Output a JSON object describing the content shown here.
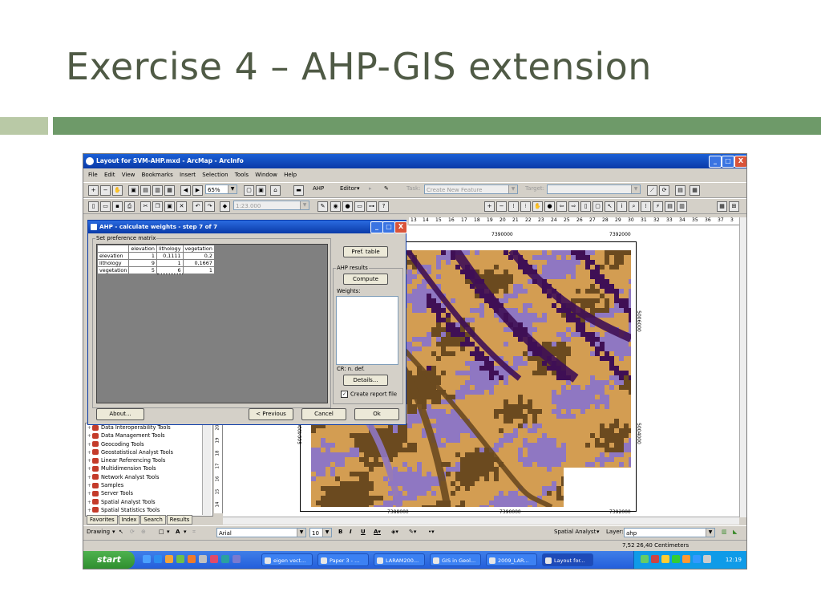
{
  "slide": {
    "title": "Exercise 4 – AHP-GIS extension"
  },
  "window": {
    "title": "Layout for SVM-AHP.mxd - ArcMap - ArcInfo",
    "controls": {
      "minimize": "_",
      "maximize": "□",
      "close": "X"
    }
  },
  "menu": [
    "File",
    "Edit",
    "View",
    "Bookmarks",
    "Insert",
    "Selection",
    "Tools",
    "Window",
    "Help"
  ],
  "toolbar": {
    "zoom": "65%",
    "ahp_label": "AHP",
    "editor_label": "Editor",
    "task_label": "Task:",
    "task_value": "Create New Feature",
    "target_label": "Target:",
    "scale_value": "1:23.000"
  },
  "dialog": {
    "title": "AHP - calculate weights - step 7 of 7",
    "controls": {
      "minimize": "_",
      "maximize": "□",
      "close": "X"
    },
    "group_matrix": "Set preference matrix",
    "matrix": {
      "columns": [
        "elevation",
        "lithology",
        "vegetation"
      ],
      "rows": [
        {
          "name": "elevation",
          "values": [
            "1",
            "0,1111",
            "0,2"
          ]
        },
        {
          "name": "lithology",
          "values": [
            "9",
            "1",
            "0,1667"
          ]
        },
        {
          "name": "vegetation",
          "values": [
            "5",
            "6",
            "1"
          ]
        }
      ]
    },
    "pref_table_button": "Pref. table",
    "group_results": "AHP results",
    "compute_button": "Compute",
    "weights_label": "Weights:",
    "cr_text": "CR: n. def.",
    "details_button": "Details...",
    "create_report_checked": true,
    "create_report_label": "Create report file",
    "about_button": "About...",
    "previous_button": "< Previous",
    "cancel_button": "Cancel",
    "ok_button": "Ok"
  },
  "toc": {
    "items": [
      "Data Interoperability Tools",
      "Data Management Tools",
      "Geocoding Tools",
      "Geostatistical Analyst Tools",
      "Linear Referencing Tools",
      "Multidimension Tools",
      "Network Analyst Tools",
      "Samples",
      "Server Tools",
      "Spatial Analyst Tools",
      "Spatial Statistics Tools"
    ],
    "tabs": [
      "Favorites",
      "Index",
      "Search",
      "Results"
    ]
  },
  "ruler": {
    "h_ticks": [
      "13",
      "14",
      "15",
      "16",
      "17",
      "18",
      "19",
      "20",
      "21",
      "22",
      "23",
      "24",
      "25",
      "26",
      "27",
      "28",
      "29",
      "30",
      "31",
      "32",
      "33",
      "34",
      "35",
      "36",
      "37",
      "3"
    ],
    "v_ticks": [
      "20",
      "19",
      "18",
      "17",
      "16",
      "15",
      "14"
    ]
  },
  "map": {
    "top_coords": [
      "7390000",
      "7392000"
    ],
    "bottom_coords": [
      "7388000",
      "7390000",
      "7392000"
    ],
    "right_coords": [
      "5006000",
      "5004000"
    ],
    "left_coords": [
      "5004000"
    ],
    "colors": {
      "purple": "#8f77c2",
      "tan": "#d39d52",
      "brown": "#6b4a1f",
      "dark": "#3f0f55"
    }
  },
  "drawing": {
    "drawing_label": "Drawing",
    "font": "Arial",
    "font_size": "10",
    "bold": "B",
    "italic": "I",
    "underline": "U",
    "spatial_analyst_label": "Spatial Analyst",
    "layer_label": "Layer:",
    "layer_value": "ahp"
  },
  "status": {
    "coords": "7,52 26,40 Centimeters"
  },
  "taskbar": {
    "start": "start",
    "items": [
      {
        "label": "eigen vect..."
      },
      {
        "label": "Paper 3 - ..."
      },
      {
        "label": "LARAM200..."
      },
      {
        "label": "GIS in Geol..."
      },
      {
        "label": "2009_LAR..."
      },
      {
        "label": "Layout for..."
      }
    ],
    "clock": "12:19"
  }
}
